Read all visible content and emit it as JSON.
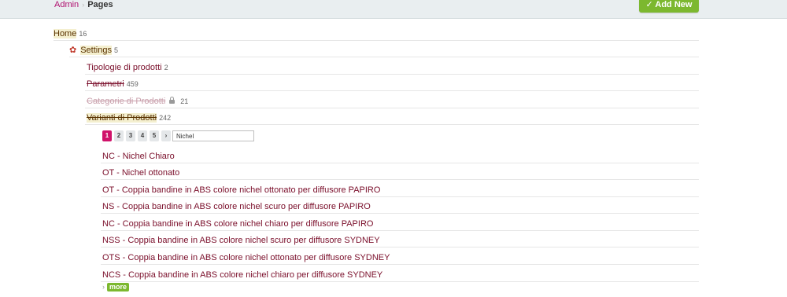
{
  "breadcrumb": {
    "admin": "Admin",
    "separator": "›",
    "current": "Pages"
  },
  "add_new": "✓ Add New",
  "tree": [
    {
      "label": "Home",
      "count": "16"
    },
    {
      "label": "Settings",
      "count": "5",
      "icon": "gear-icon"
    },
    {
      "label": "Tipologie di prodotti",
      "count": "2"
    },
    {
      "label": "Parametri",
      "count": "459"
    },
    {
      "label": "Categorie di Prodotti",
      "count": "21",
      "icon": "lock-icon"
    },
    {
      "label": "Varianti di Prodotti",
      "count": "242"
    }
  ],
  "pager": {
    "pages": [
      "1",
      "2",
      "3",
      "4",
      "5"
    ],
    "next": "›",
    "search_value": "Nichel",
    "active_page": "1"
  },
  "items": [
    "NC - Nichel Chiaro",
    "OT - Nichel ottonato",
    "OT - Coppia bandine in ABS colore nichel ottonato per diffusore PAPIRO",
    "NS - Coppia bandine in ABS colore nichel scuro per diffusore PAPIRO",
    "NC - Coppia bandine in ABS colore nichel chiaro per diffusore PAPIRO",
    "NSS - Coppia bandine in ABS colore nichel scuro per diffusore SYDNEY",
    "OTS - Coppia bandine in ABS colore nichel ottonato per diffusore SYDNEY",
    "NCS - Coppia bandine in ABS colore nichel chiaro per diffusore SYDNEY"
  ],
  "more": {
    "chevron": "›",
    "label": "more"
  },
  "colors": {
    "accent": "#d0126a",
    "green": "#7cb82f",
    "link": "#7a0e2a"
  }
}
